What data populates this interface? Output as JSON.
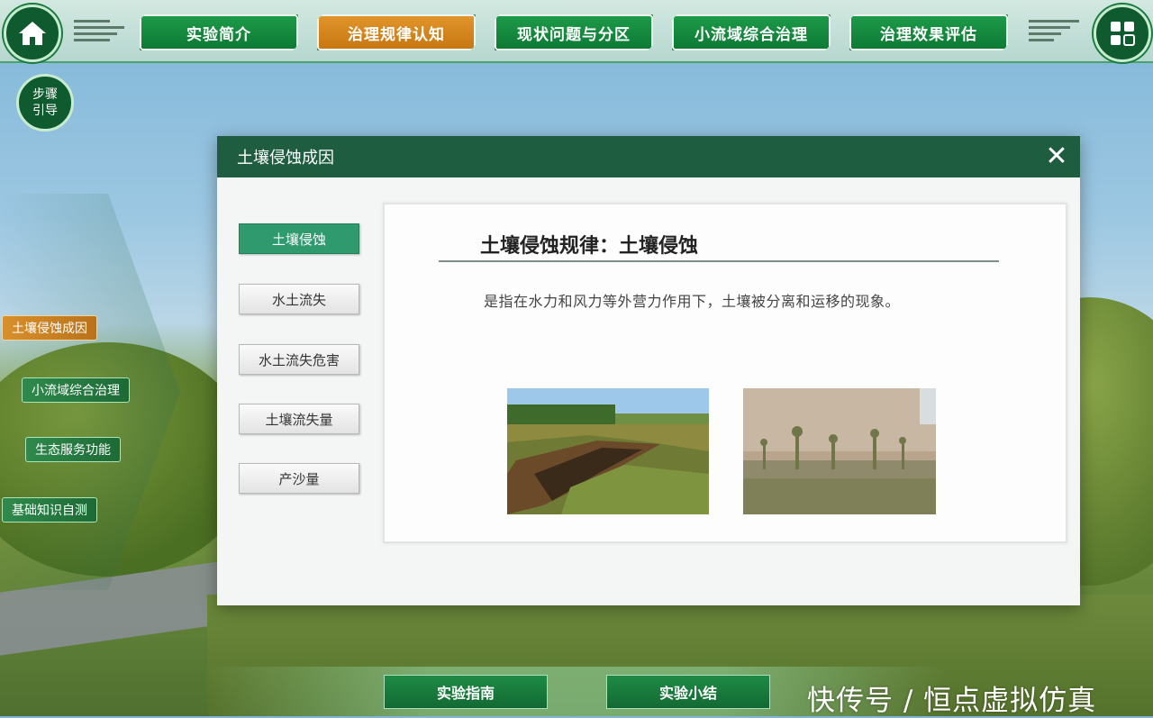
{
  "top_nav": {
    "items": [
      {
        "label": "实验简介"
      },
      {
        "label": "治理规律认知"
      },
      {
        "label": "现状问题与分区"
      },
      {
        "label": "小流域综合治理"
      },
      {
        "label": "治理效果评估"
      }
    ],
    "active_index": 1
  },
  "step_guide": {
    "line1": "步骤",
    "line2": "引导"
  },
  "side_menu": {
    "items": [
      {
        "label": "土壤侵蚀成因"
      },
      {
        "label": "小流域综合治理"
      },
      {
        "label": "生态服务功能"
      },
      {
        "label": "基础知识自测"
      }
    ],
    "active_index": 0
  },
  "modal": {
    "title": "土壤侵蚀成因",
    "close_symbol": "✕",
    "tabs": [
      {
        "label": "土壤侵蚀"
      },
      {
        "label": "水土流失"
      },
      {
        "label": "水土流失危害"
      },
      {
        "label": "土壤流失量"
      },
      {
        "label": "产沙量"
      }
    ],
    "active_tab": 0,
    "content": {
      "heading": "土壤侵蚀规律：土壤侵蚀",
      "description": "是指在水力和风力等外营力作用下，土壤被分离和运移的现象。"
    }
  },
  "bottom": {
    "guide_label": "实验指南",
    "summary_label": "实验小结"
  },
  "watermark": "快传号 / 恒点虚拟仿真",
  "colors": {
    "primary_green": "#1f5d40",
    "nav_green": "#1d9a49",
    "active_orange": "#e0952a",
    "tab_active": "#2e9a6e"
  }
}
